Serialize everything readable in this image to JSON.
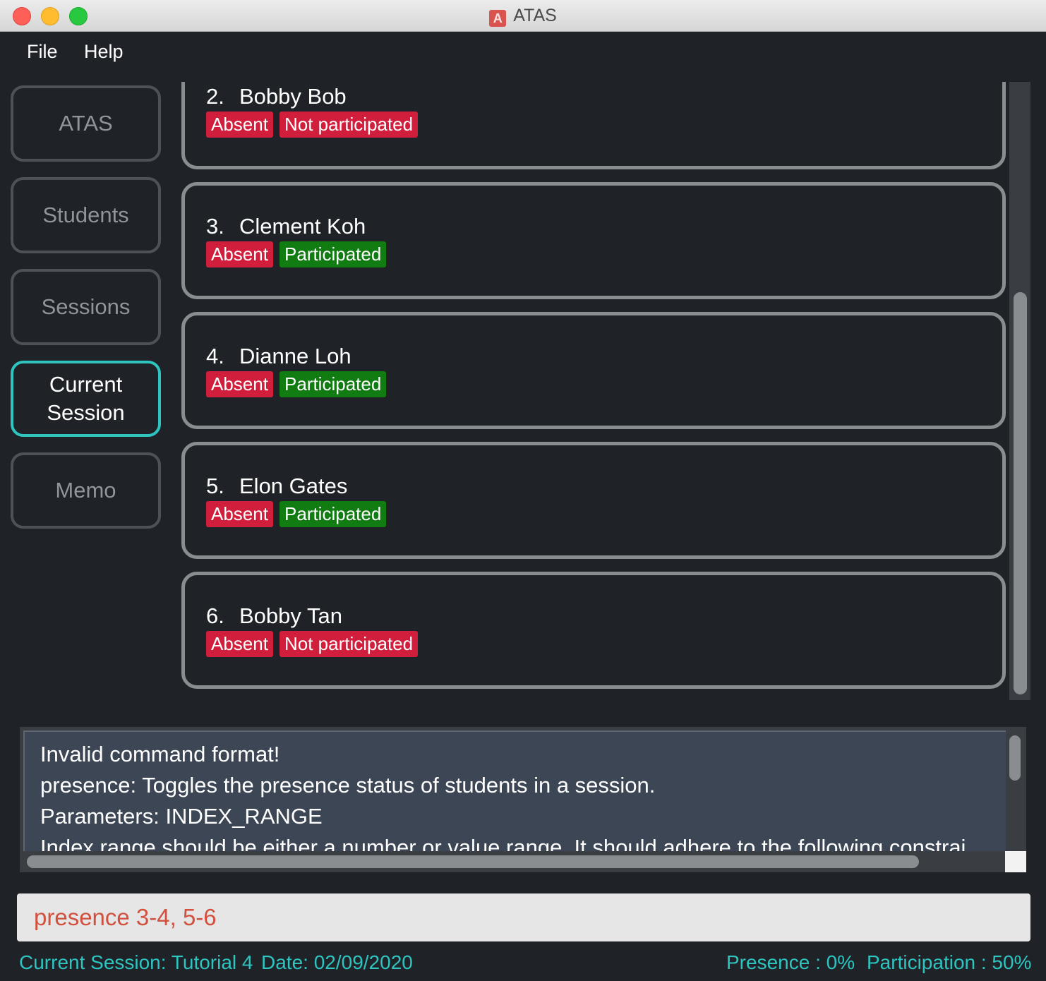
{
  "window": {
    "title": "ATAS",
    "app_icon_letter": "A"
  },
  "menu": {
    "file": "File",
    "help": "Help"
  },
  "sidebar": {
    "atas": "ATAS",
    "students": "Students",
    "sessions": "Sessions",
    "current_session": "Current Session",
    "memo": "Memo",
    "active": "Current Session"
  },
  "attendance": [
    {
      "index": "2.",
      "name": "Bobby Bob",
      "presence": "Absent",
      "participation": "Not participated"
    },
    {
      "index": "3.",
      "name": "Clement Koh",
      "presence": "Absent",
      "participation": "Participated"
    },
    {
      "index": "4.",
      "name": "Dianne Loh",
      "presence": "Absent",
      "participation": "Participated"
    },
    {
      "index": "5.",
      "name": "Elon Gates",
      "presence": "Absent",
      "participation": "Participated"
    },
    {
      "index": "6.",
      "name": "Bobby Tan",
      "presence": "Absent",
      "participation": "Not participated"
    }
  ],
  "result_display": {
    "lines": [
      "Invalid command format!",
      "presence: Toggles the presence status of students in a session.",
      "Parameters: INDEX_RANGE",
      "Index range should be either a number or value range. It should adhere to the following constrai"
    ]
  },
  "command_box": {
    "value": "presence 3-4, 5-6"
  },
  "status_bar": {
    "current_session": "Current Session: Tutorial 4",
    "date": "Date: 02/09/2020",
    "presence": "Presence : 0%",
    "participation": "Participation : 50%"
  },
  "colors": {
    "accent": "#2ec4c0",
    "absent_tag": "#d11e3d",
    "participated_tag": "#117c11",
    "command_text": "#d1513f"
  }
}
